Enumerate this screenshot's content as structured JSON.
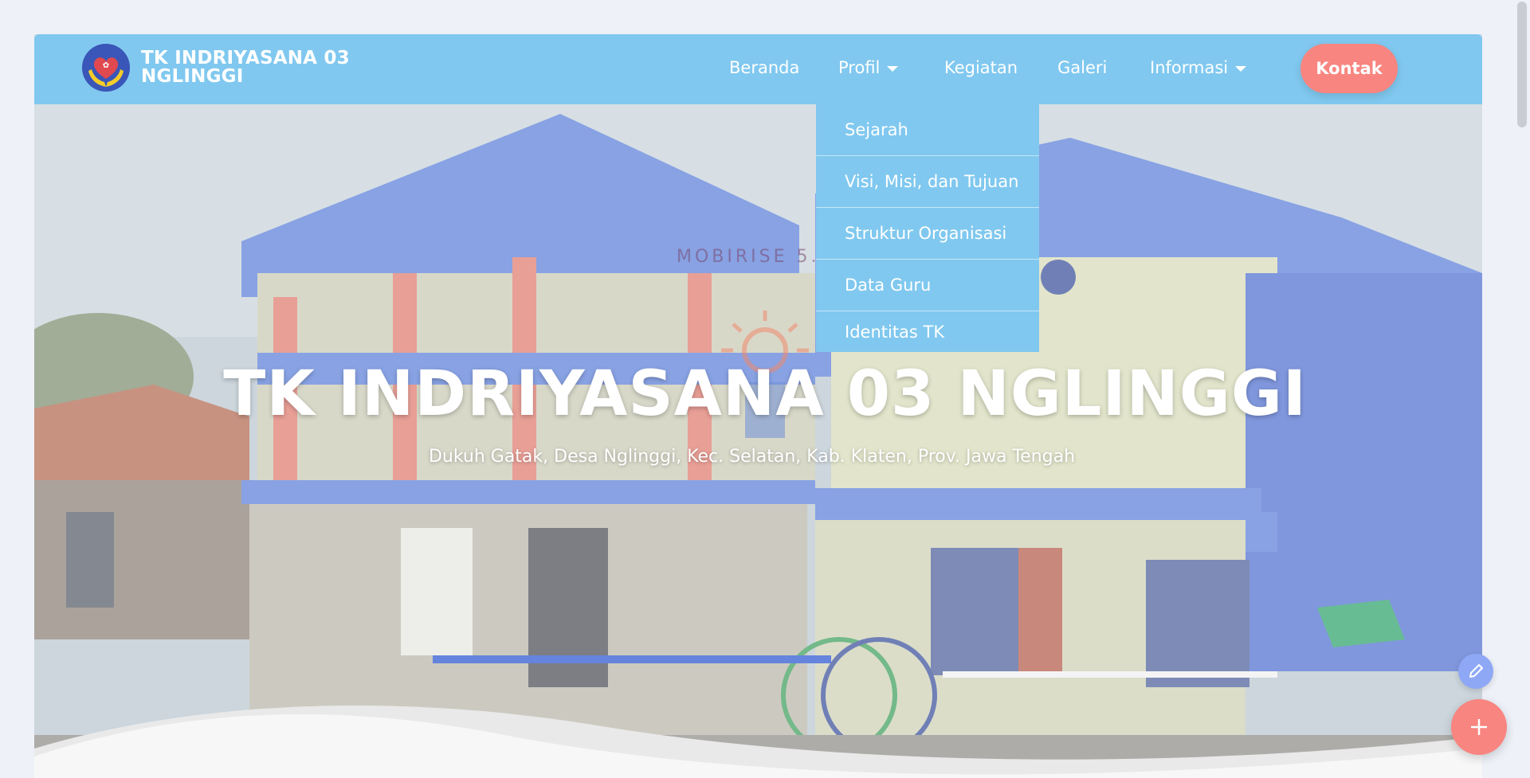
{
  "brand": {
    "name": "TK INDRIYASANA 03 NGLINGGI",
    "logo_icon": "heart-hands-logo-icon"
  },
  "nav": {
    "items": [
      {
        "label": "Beranda",
        "has_caret": false
      },
      {
        "label": "Profil",
        "has_caret": true
      },
      {
        "label": "Kegiatan",
        "has_caret": false
      },
      {
        "label": "Galeri",
        "has_caret": false
      },
      {
        "label": "Informasi",
        "has_caret": true
      }
    ],
    "contact_label": "Kontak"
  },
  "dropdown": {
    "items": [
      "Sejarah",
      "Visi, Misi, dan Tujuan",
      "Struktur Organisasi",
      "Data Guru",
      "Identitas TK"
    ]
  },
  "watermark": "MOBIRISE 5.9.6",
  "hero": {
    "title": "TK INDRIYASANA 03 NGLINGGI",
    "subtitle": "Dukuh Gatak, Desa Nglinggi, Kec. Selatan, Kab. Klaten, Prov. Jawa Tengah"
  },
  "fab": {
    "edit_icon": "pencil-icon",
    "add_icon": "plus-icon"
  },
  "colors": {
    "navbar": "#80c8ef",
    "accent": "#f88580",
    "edit_button": "#8ea8f5",
    "page_bg": "#eef1f8"
  }
}
